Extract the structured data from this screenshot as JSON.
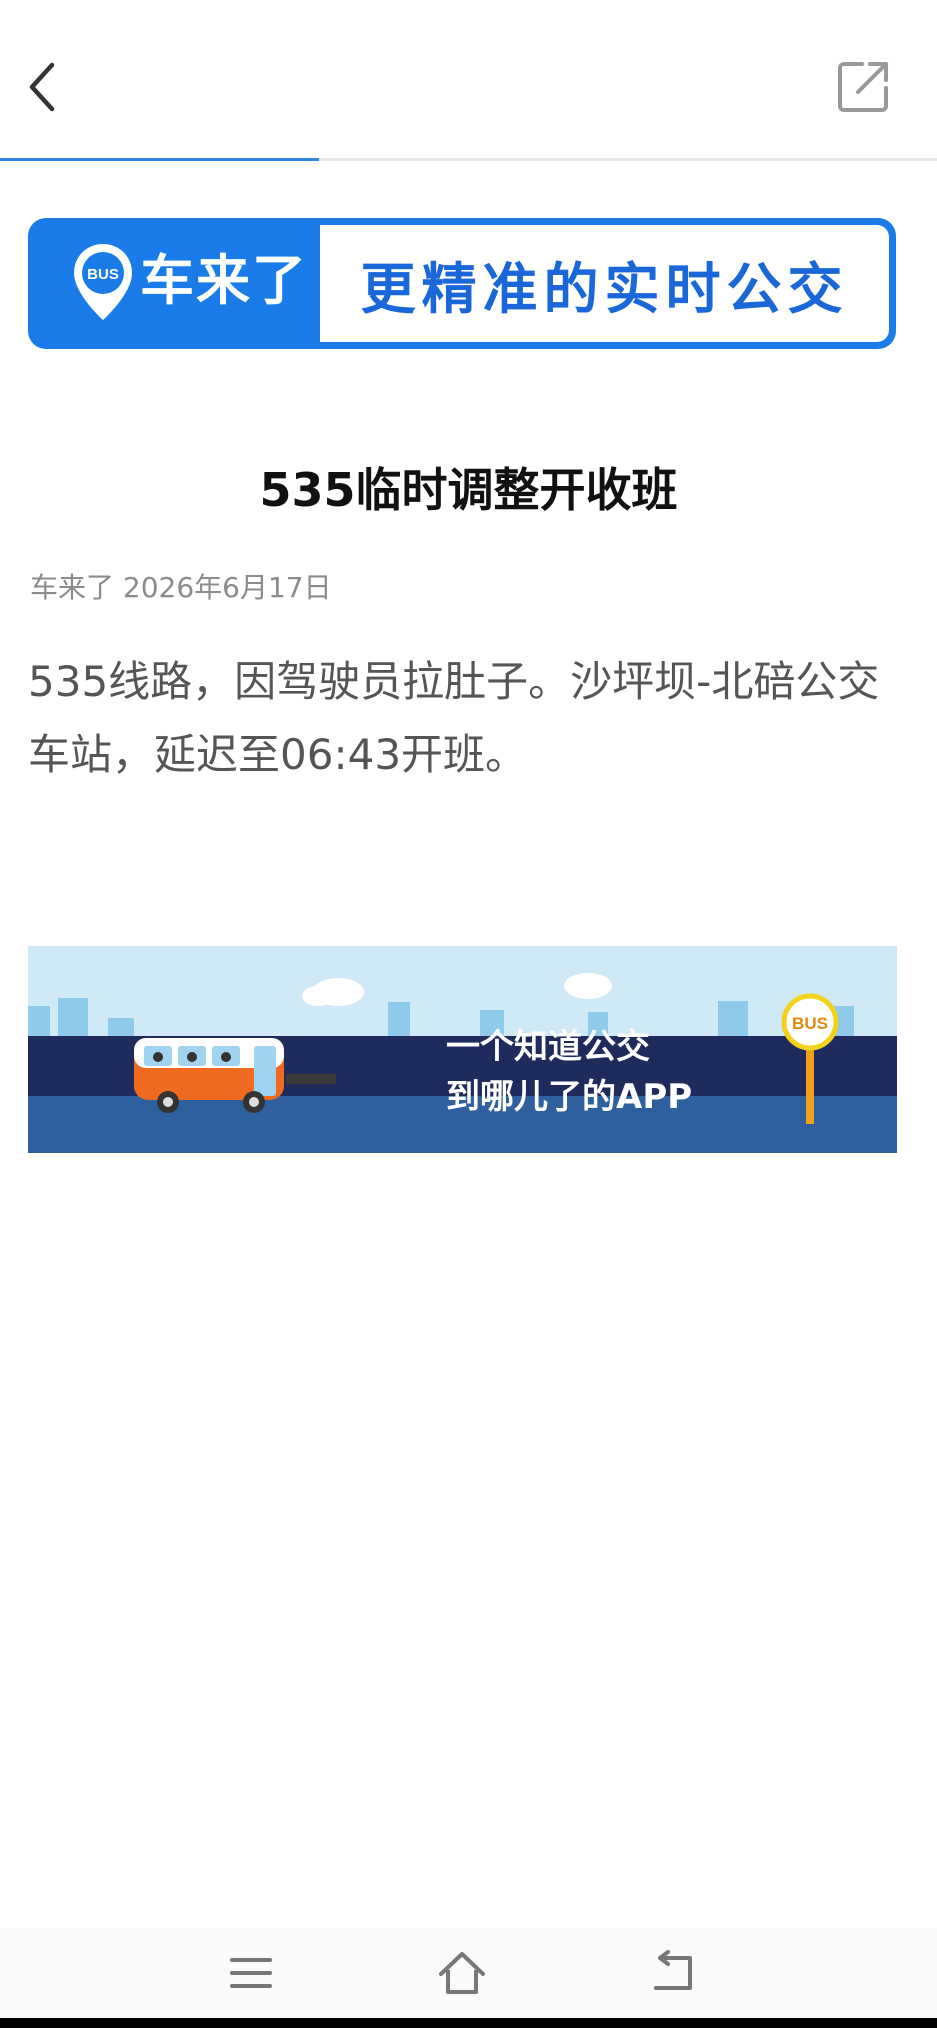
{
  "header": {
    "back_icon": "chevron-left-icon",
    "share_icon": "external-share-icon",
    "load_progress": 0.34
  },
  "banner": {
    "badge_text": "BUS",
    "brand": "车来了",
    "slogan": "更精准的实时公交",
    "colors": {
      "brand_blue": "#1a7ce9",
      "slogan_blue": "#1a67d9"
    }
  },
  "article": {
    "title": "535临时调整开收班",
    "meta": "车来了 2026年6月17日",
    "body": "535线路，因驾驶员拉肚子。沙坪坝-北碚公交车站，延迟至06:43开班。"
  },
  "ad": {
    "line1": "一个知道公交",
    "line2": "到哪儿了的APP",
    "stop_sign": "BUS"
  },
  "navbar": {
    "menu_icon": "menu-icon",
    "home_icon": "home-icon",
    "back_icon": "return-icon"
  }
}
